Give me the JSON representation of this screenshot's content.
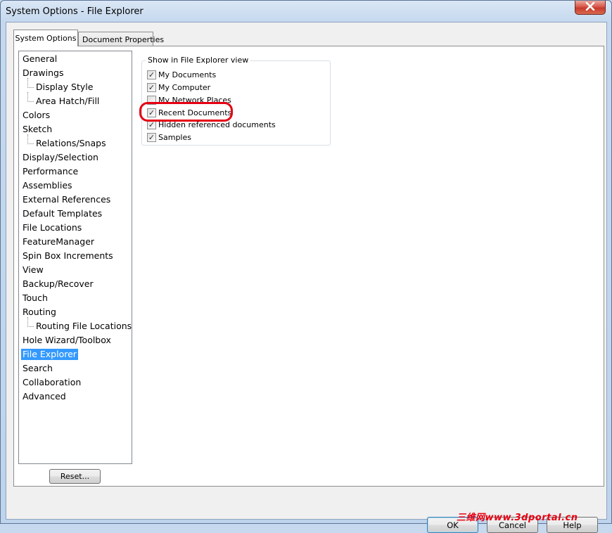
{
  "window": {
    "title": "System Options - File Explorer",
    "close_icon": "close-icon"
  },
  "tabs": [
    {
      "label": "System Options",
      "active": true
    },
    {
      "label": "Document Properties",
      "active": false
    }
  ],
  "tree": {
    "items": [
      {
        "label": "General",
        "level": 0
      },
      {
        "label": "Drawings",
        "level": 0
      },
      {
        "label": "Display Style",
        "level": 1
      },
      {
        "label": "Area Hatch/Fill",
        "level": 1
      },
      {
        "label": "Colors",
        "level": 0
      },
      {
        "label": "Sketch",
        "level": 0
      },
      {
        "label": "Relations/Snaps",
        "level": 1
      },
      {
        "label": "Display/Selection",
        "level": 0
      },
      {
        "label": "Performance",
        "level": 0
      },
      {
        "label": "Assemblies",
        "level": 0
      },
      {
        "label": "External References",
        "level": 0
      },
      {
        "label": "Default Templates",
        "level": 0
      },
      {
        "label": "File Locations",
        "level": 0
      },
      {
        "label": "FeatureManager",
        "level": 0
      },
      {
        "label": "Spin Box Increments",
        "level": 0
      },
      {
        "label": "View",
        "level": 0
      },
      {
        "label": "Backup/Recover",
        "level": 0
      },
      {
        "label": "Touch",
        "level": 0
      },
      {
        "label": "Routing",
        "level": 0
      },
      {
        "label": "Routing File Locations",
        "level": 1
      },
      {
        "label": "Hole Wizard/Toolbox",
        "level": 0
      },
      {
        "label": "File Explorer",
        "level": 0,
        "selected": true
      },
      {
        "label": "Search",
        "level": 0
      },
      {
        "label": "Collaboration",
        "level": 0
      },
      {
        "label": "Advanced",
        "level": 0
      }
    ],
    "selected_color": "#3399ff"
  },
  "reset_label": "Reset...",
  "group": {
    "title": "Show in File Explorer view",
    "options": [
      {
        "label": "My Documents",
        "checked": true
      },
      {
        "label": "My Computer",
        "checked": true
      },
      {
        "label": "My Network Places",
        "checked": false
      },
      {
        "label": "Recent Documents",
        "checked": true
      },
      {
        "label": "Hidden referenced documents",
        "checked": true
      },
      {
        "label": "Samples",
        "checked": true
      }
    ]
  },
  "highlight_color": "#e60012",
  "buttons": {
    "ok": "OK",
    "cancel": "Cancel",
    "help": "Help"
  },
  "watermark": "三维网www.3dportal.cn"
}
